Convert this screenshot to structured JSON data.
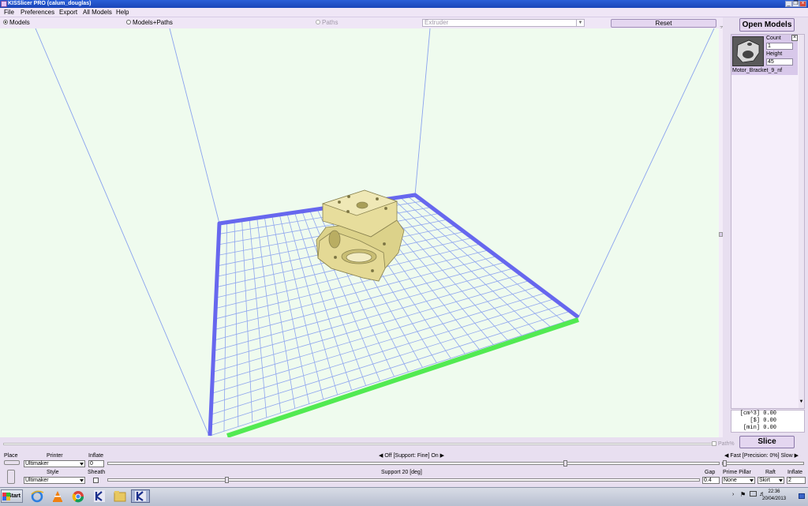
{
  "window": {
    "title": "KISSlicer PRO (calum_douglas)",
    "controls": [
      "_",
      "❐",
      "×"
    ]
  },
  "menu": {
    "items": [
      "File",
      "Preferences",
      "Export",
      "All Models",
      "Help"
    ]
  },
  "view_modes": {
    "models": "Models",
    "models_paths": "Models+Paths",
    "paths": "Paths",
    "selected": "Models"
  },
  "extruder_select": {
    "value": "Extruder"
  },
  "reset_button": "Reset",
  "axis_label_z": "Z",
  "right_panel": {
    "open_models_button": "Open Models",
    "model": {
      "count_label": "Count",
      "count_value": "1",
      "height_label": "Height",
      "height_value": "45",
      "name": "Motor_Bracket_9_nf",
      "close_label": "×"
    },
    "stats": {
      "volume_label": "[cm^3]",
      "volume_value": "0.00",
      "cost_label": "[$]",
      "cost_value": "0.00",
      "time_label": "[min]",
      "time_value": "0.00"
    },
    "slice_button": "Slice"
  },
  "bottom": {
    "path_label": "Path%",
    "place_label": "Place",
    "printer_label": "Printer",
    "printer_value": "Ultimaker",
    "inflate_label": "Inflate",
    "inflate_value": "0",
    "support_toggle": "Off [Support: Fine] On",
    "support_level": 0.75,
    "speed_toggle": "Fast [Precision: 0%] Slow",
    "style_label": "Style",
    "style_value": "Ultimaker",
    "sheath_label": "Sheath",
    "support_angle": "Support 20 [deg]",
    "support_angle_level": 0.2,
    "gap_label": "Gap",
    "gap_value": "0.4",
    "prime_pillar_label": "Prime Pillar",
    "prime_pillar_value": "None",
    "raft_label": "Raft",
    "raft_value": "Skirt",
    "raft_inflate_label": "Inflate",
    "raft_inflate_value": "2"
  },
  "taskbar": {
    "start_label": "Start",
    "time": "22:36",
    "date": "20/04/2013",
    "icons": [
      "ie-icon",
      "vlc-icon",
      "chrome-icon",
      "kisslicer-icon",
      "folder-icon",
      "kisslicer-active-icon"
    ]
  },
  "colors": {
    "viewport_bg": "#effbee",
    "grid_line": "#8aa2ee",
    "bed_edge_back": "#6b6bf0",
    "bed_edge_front": "#55ee55",
    "model": "#e8df9e",
    "panel_bg": "#efe6f6"
  }
}
